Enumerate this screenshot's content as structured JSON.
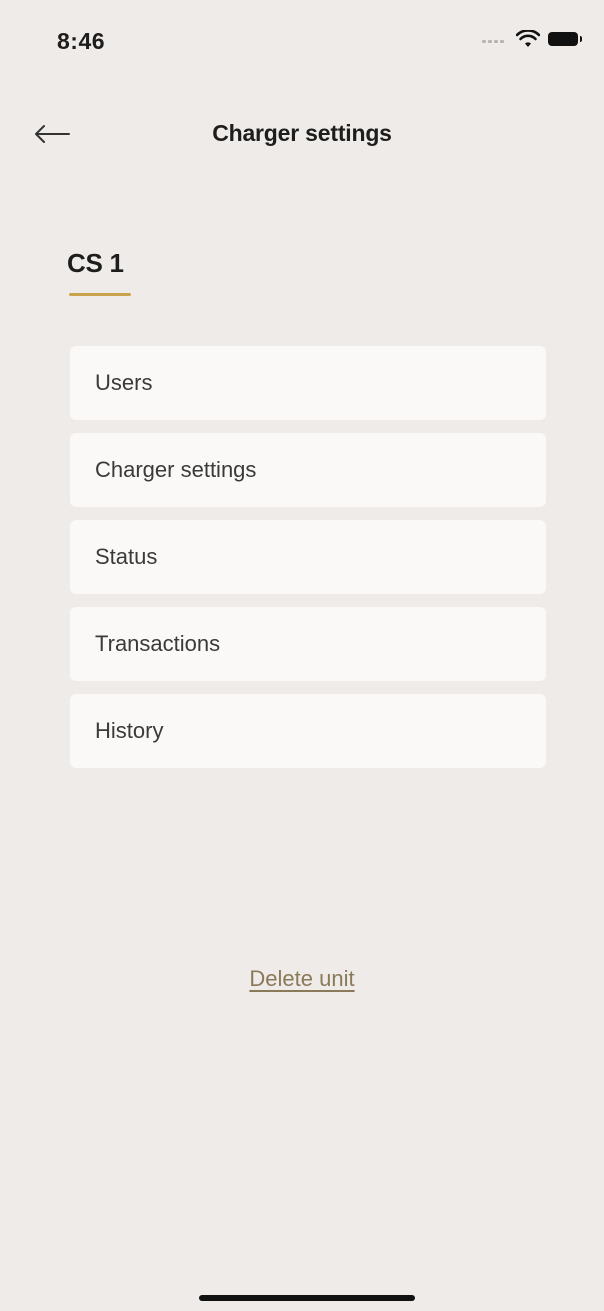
{
  "status_bar": {
    "time": "8:46",
    "icons": [
      "signal-icon",
      "wifi-icon",
      "battery-icon"
    ]
  },
  "nav": {
    "back_icon": "arrow-left-icon",
    "title": "Charger settings"
  },
  "unit": {
    "name": "CS 1",
    "accent_color": "#c9a44a"
  },
  "menu": {
    "items": [
      {
        "label": "Users"
      },
      {
        "label": "Charger settings"
      },
      {
        "label": "Status"
      },
      {
        "label": "Transactions"
      },
      {
        "label": "History"
      }
    ]
  },
  "actions": {
    "delete_label": "Delete unit",
    "delete_color": "#8a7a5a"
  }
}
